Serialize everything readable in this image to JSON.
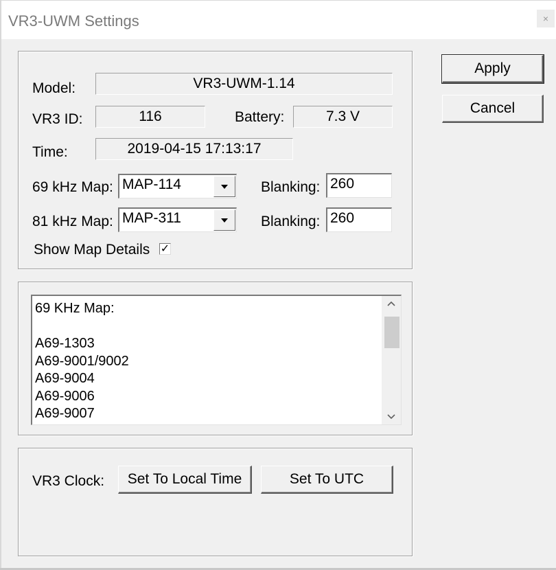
{
  "window": {
    "title": "VR3-UWM Settings",
    "close_glyph": "×"
  },
  "info": {
    "model_label": "Model:",
    "model_value": "VR3-UWM-1.14",
    "id_label": "VR3 ID:",
    "id_value": "116",
    "battery_label": "Battery:",
    "battery_value": "7.3 V",
    "time_label": "Time:",
    "time_value": "2019-04-15  17:13:17"
  },
  "maps": {
    "map69_label": "69 kHz Map:",
    "map69_value": "MAP-114",
    "blanking69_label": "Blanking:",
    "blanking69_value": "260",
    "map81_label": "81 kHz Map:",
    "map81_value": "MAP-311",
    "blanking81_label": "Blanking:",
    "blanking81_value": "260",
    "show_details_label": "Show Map Details",
    "show_details_checked": true
  },
  "details_list": {
    "items": [
      "69 KHz Map:",
      "",
      "A69-1303",
      "A69-9001/9002",
      "A69-9004",
      "A69-9006",
      "A69-9007"
    ]
  },
  "clock": {
    "label": "VR3 Clock:",
    "local_button": "Set To Local Time",
    "utc_button": "Set To UTC"
  },
  "actions": {
    "apply": "Apply",
    "cancel": "Cancel"
  },
  "icons": {
    "checkmark": "check-icon",
    "dropdown": "chevron-down-icon",
    "scroll_up": "chevron-up-icon",
    "scroll_down": "chevron-down-icon"
  },
  "colors": {
    "window_bg": "#f0f0f0",
    "titlebar_bg": "#ffffff",
    "title_text": "#7a7a7a"
  }
}
